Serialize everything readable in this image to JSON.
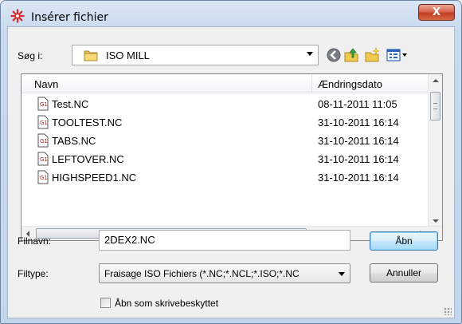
{
  "window": {
    "title": "Insérer fichier",
    "close_label": "X"
  },
  "lookin": {
    "label": "Søg i:",
    "value": "ISO MILL"
  },
  "toolbar": {
    "icons": [
      "back-icon",
      "up-folder-icon",
      "new-folder-icon",
      "view-menu-icon"
    ]
  },
  "filelist": {
    "columns": {
      "name": "Navn",
      "date": "Ændringsdato"
    },
    "rows": [
      {
        "name": "Test.NC",
        "date": "08-11-2011 11:05"
      },
      {
        "name": "TOOLTEST.NC",
        "date": "31-10-2011 16:14"
      },
      {
        "name": "TABS.NC",
        "date": "31-10-2011 16:14"
      },
      {
        "name": "LEFTOVER.NC",
        "date": "31-10-2011 16:14"
      },
      {
        "name": "HIGHSPEED1.NC",
        "date": "31-10-2011 16:14"
      }
    ],
    "hscroll_grip": "III"
  },
  "filename": {
    "label": "Filnavn:",
    "value": "2DEX2.NC"
  },
  "filetype": {
    "label": "Filtype:",
    "value": "Fraisage ISO Fichiers (*.NC;*.NCL;*.ISO;*.NC"
  },
  "buttons": {
    "open": "Åbn",
    "cancel": "Annuller"
  },
  "readonly": {
    "label": "Åbn som skrivebeskyttet",
    "checked": false
  },
  "colors": {
    "title_gradient_top": "#d9e6f4",
    "close_button": "#c23d22",
    "default_button": "#3c7fb1"
  }
}
